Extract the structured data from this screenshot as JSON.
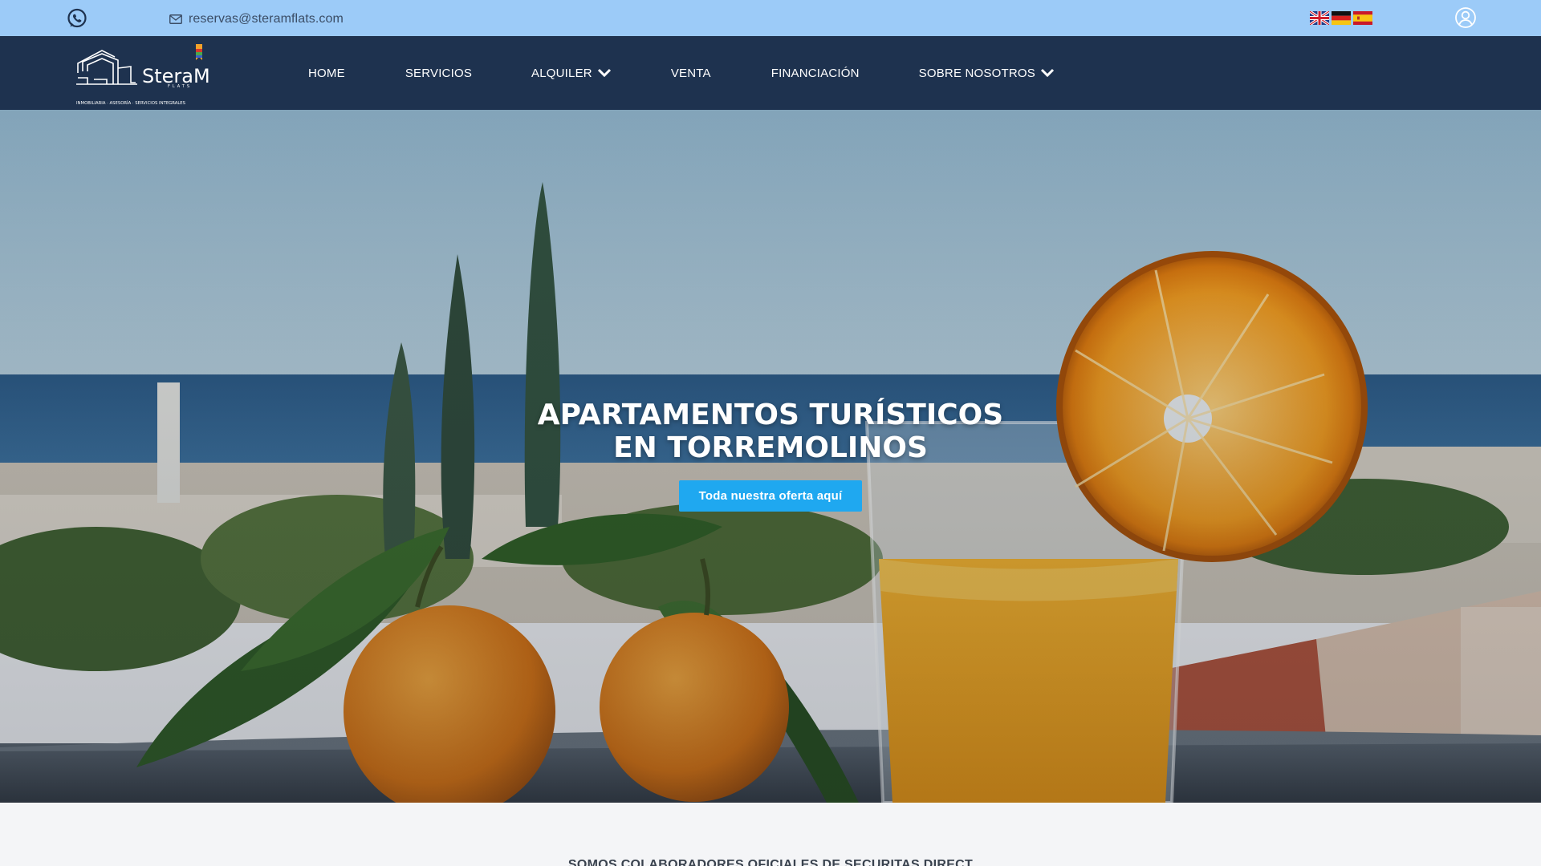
{
  "topbar": {
    "whatsapp_icon": "whatsapp-icon",
    "email": "reservas@steramflats.com",
    "mail_icon": "mail-icon",
    "languages": [
      "English",
      "Deutsch",
      "Español"
    ],
    "user_icon": "user-account-icon"
  },
  "nav": {
    "logo": {
      "brand": "SteraM",
      "sub": "FLATS",
      "tagline": "INMOBILIARIA · ASESORÍA · SERVICIOS INTEGRALES"
    },
    "items": [
      {
        "label": "HOME",
        "has_dropdown": false
      },
      {
        "label": "SERVICIOS",
        "has_dropdown": false
      },
      {
        "label": "ALQUILER",
        "has_dropdown": true
      },
      {
        "label": "VENTA",
        "has_dropdown": false
      },
      {
        "label": "FINANCIACIÓN",
        "has_dropdown": false
      },
      {
        "label": "SOBRE NOSOTROS",
        "has_dropdown": true
      }
    ]
  },
  "hero": {
    "title_line1": "APARTAMENTOS TURÍSTICOS",
    "title_line2": "EN TORREMOLINOS",
    "cta_label": "Toda nuestra oferta aquí"
  },
  "partners": {
    "heading": "SOMOS COLABORADORES OFICIALES DE SECURITAS DIRECT"
  },
  "colors": {
    "topbar": "#9ccbf8",
    "nav": "#1e324f",
    "cta": "#1fa8f0",
    "page_bg": "#f4f5f7"
  }
}
